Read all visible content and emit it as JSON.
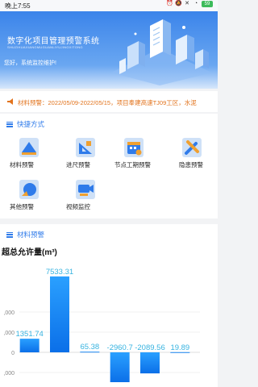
{
  "status_bar": {
    "time": "晚上7:55",
    "battery": "59",
    "icons": [
      "alarm-icon",
      "mute-icon",
      "close-icon",
      "wifi-icon",
      "battery-icon"
    ]
  },
  "banner": {
    "title": "数字化项目管理预警系统",
    "subtitle": "SHUZIHUAXIANGMUGUANLIYUJINGXITONG",
    "greeting": "您好，系统监控维护!"
  },
  "notice": {
    "text": "材料预警：2022/05/09-2022/05/15，项目奉建高速TJ09工区，水泥",
    "icon": "megaphone-icon",
    "color": "#e2731c"
  },
  "quick_access": {
    "title": "快捷方式",
    "items": [
      {
        "label": "材料预警",
        "icon": "material-warning-icon"
      },
      {
        "label": "进尺预警",
        "icon": "progress-warning-icon"
      },
      {
        "label": "节点工期预警",
        "icon": "milestone-warning-icon"
      },
      {
        "label": "隐患预警",
        "icon": "hazard-warning-icon"
      },
      {
        "label": "其他预警",
        "icon": "other-warning-icon"
      },
      {
        "label": "视频监控",
        "icon": "video-camera-icon"
      }
    ]
  },
  "material_section": {
    "title": "材料预警"
  },
  "chart_data": {
    "type": "bar",
    "title": "超总允许量(m³)",
    "series": [
      {
        "values": [
          1351.74,
          7533.31,
          65.38,
          -2960.7,
          -2089.56,
          19.89
        ]
      }
    ],
    "value_labels": [
      "1351.74",
      "7533.31",
      "65.38",
      "-2960.7",
      "-2089.56",
      "19.89"
    ],
    "y_ticks": [
      ",000",
      ",000",
      "0",
      ",000"
    ],
    "grid": true,
    "accent": "#1e8cff",
    "label_color": "#36b3e0"
  },
  "colors": {
    "primary": "#2f7bea",
    "notice": "#e2731c"
  }
}
